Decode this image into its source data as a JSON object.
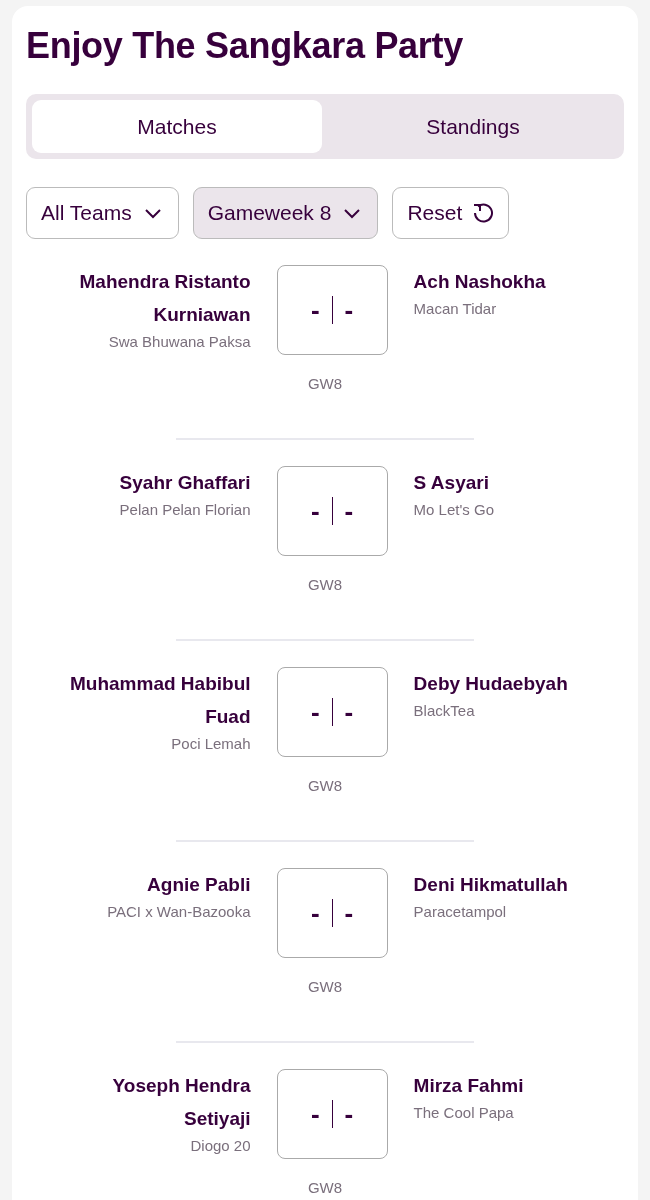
{
  "title": "Enjoy The Sangkara Party",
  "tabs": [
    {
      "label": "Matches",
      "selected": true
    },
    {
      "label": "Standings",
      "selected": false
    }
  ],
  "filters": [
    {
      "kind": "dropdown",
      "label": "All Teams",
      "active": false
    },
    {
      "kind": "dropdown",
      "label": "Gameweek 8",
      "active": true
    },
    {
      "kind": "reset",
      "label": "Reset",
      "active": false
    }
  ],
  "matches": [
    {
      "home": {
        "player": "Mahendra Ristanto Kurniawan",
        "team": "Swa Bhuwana Paksa"
      },
      "away": {
        "player": "Ach Nashokha",
        "team": "Macan Tidar"
      },
      "home_score": "-",
      "away_score": "-",
      "gameweek": "GW8"
    },
    {
      "home": {
        "player": "Syahr Ghaffari",
        "team": "Pelan Pelan Florian"
      },
      "away": {
        "player": "S Asyari",
        "team": "Mo Let's Go"
      },
      "home_score": "-",
      "away_score": "-",
      "gameweek": "GW8"
    },
    {
      "home": {
        "player": "Muhammad Habibul Fuad",
        "team": "Poci Lemah"
      },
      "away": {
        "player": "Deby Hudaebyah",
        "team": "BlackTea"
      },
      "home_score": "-",
      "away_score": "-",
      "gameweek": "GW8"
    },
    {
      "home": {
        "player": "Agnie Pabli",
        "team": "PACI x Wan-Bazooka"
      },
      "away": {
        "player": "Deni Hikmatullah",
        "team": "Paracetampol"
      },
      "home_score": "-",
      "away_score": "-",
      "gameweek": "GW8"
    },
    {
      "home": {
        "player": "Yoseph Hendra Setiyaji",
        "team": "Diogo 20"
      },
      "away": {
        "player": "Mirza Fahmi",
        "team": "The Cool Papa"
      },
      "home_score": "-",
      "away_score": "-",
      "gameweek": "GW8"
    }
  ]
}
